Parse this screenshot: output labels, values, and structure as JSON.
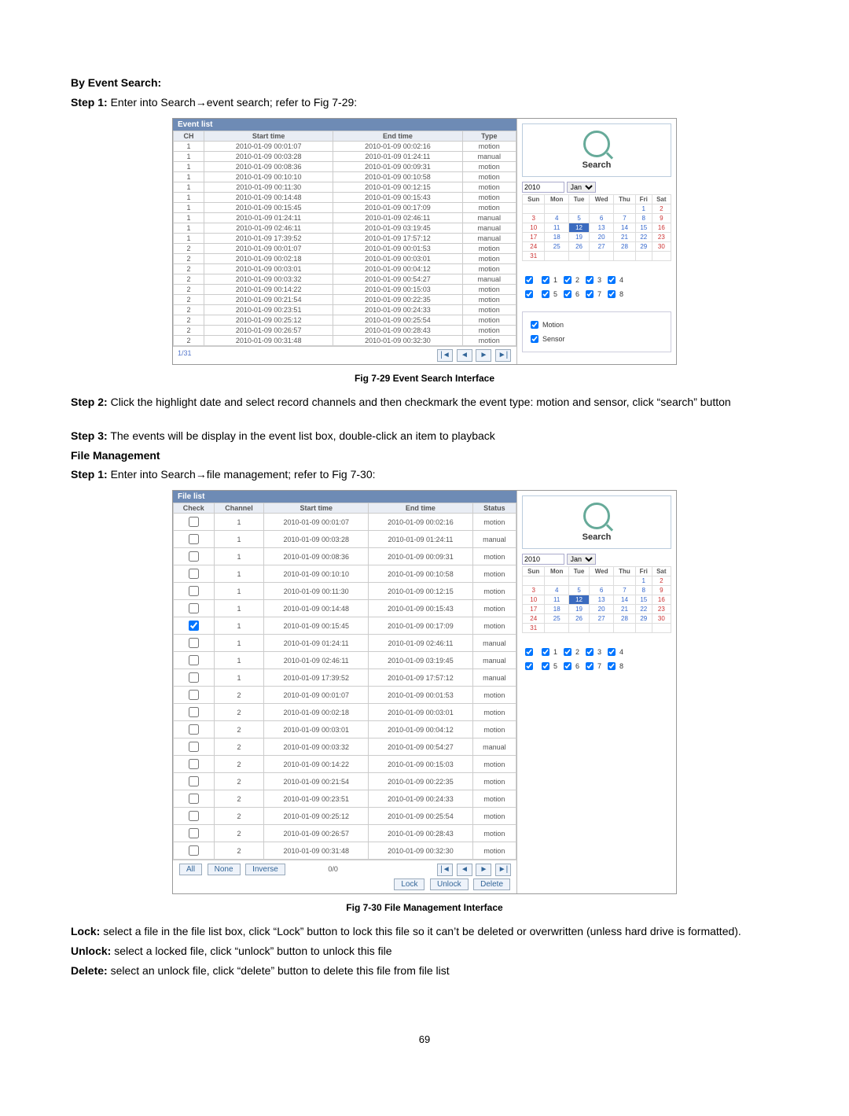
{
  "headings": {
    "by_event": "By Event Search:",
    "file_mgmt": "File Management"
  },
  "steps": {
    "e1_a": "Step 1:",
    "e1_b": " Enter into Search→event search; refer to Fig 7-29:",
    "e2_a": "Step 2:",
    "e2_b": " Click the highlight date and select record channels and then checkmark the event type: motion and sensor, click “search” button",
    "e3_a": "Step 3:",
    "e3_b": " The events will be display in the event list box, double-click an item to playback",
    "f1_a": "Step 1:",
    "f1_b": " Enter into Search→file management; refer to Fig 7-30:"
  },
  "captions": {
    "fig29": "Fig 7-29 Event Search Interface",
    "fig30": "Fig 7-30 File Management Interface"
  },
  "defs": {
    "lock_a": "Lock:",
    "lock_b": " select a file in the file list box, click “Lock” button to lock this file so it can’t be deleted or overwritten (unless hard drive is formatted).",
    "unlock_a": "Unlock:",
    "unlock_b": " select a locked file, click “unlock” button to unlock this file",
    "delete_a": "Delete:",
    "delete_b": " select an unlock file, click “delete” button to delete this file from file list"
  },
  "page_number": "69",
  "event_panel": {
    "title": "Event list",
    "cols": [
      "CH",
      "Start time",
      "End time",
      "Type"
    ],
    "rows": [
      [
        "1",
        "2010-01-09 00:01:07",
        "2010-01-09 00:02:16",
        "motion"
      ],
      [
        "1",
        "2010-01-09 00:03:28",
        "2010-01-09 01:24:11",
        "manual"
      ],
      [
        "1",
        "2010-01-09 00:08:36",
        "2010-01-09 00:09:31",
        "motion"
      ],
      [
        "1",
        "2010-01-09 00:10:10",
        "2010-01-09 00:10:58",
        "motion"
      ],
      [
        "1",
        "2010-01-09 00:11:30",
        "2010-01-09 00:12:15",
        "motion"
      ],
      [
        "1",
        "2010-01-09 00:14:48",
        "2010-01-09 00:15:43",
        "motion"
      ],
      [
        "1",
        "2010-01-09 00:15:45",
        "2010-01-09 00:17:09",
        "motion"
      ],
      [
        "1",
        "2010-01-09 01:24:11",
        "2010-01-09 02:46:11",
        "manual"
      ],
      [
        "1",
        "2010-01-09 02:46:11",
        "2010-01-09 03:19:45",
        "manual"
      ],
      [
        "1",
        "2010-01-09 17:39:52",
        "2010-01-09 17:57:12",
        "manual"
      ],
      [
        "2",
        "2010-01-09 00:01:07",
        "2010-01-09 00:01:53",
        "motion"
      ],
      [
        "2",
        "2010-01-09 00:02:18",
        "2010-01-09 00:03:01",
        "motion"
      ],
      [
        "2",
        "2010-01-09 00:03:01",
        "2010-01-09 00:04:12",
        "motion"
      ],
      [
        "2",
        "2010-01-09 00:03:32",
        "2010-01-09 00:54:27",
        "manual"
      ],
      [
        "2",
        "2010-01-09 00:14:22",
        "2010-01-09 00:15:03",
        "motion"
      ],
      [
        "2",
        "2010-01-09 00:21:54",
        "2010-01-09 00:22:35",
        "motion"
      ],
      [
        "2",
        "2010-01-09 00:23:51",
        "2010-01-09 00:24:33",
        "motion"
      ],
      [
        "2",
        "2010-01-09 00:25:12",
        "2010-01-09 00:25:54",
        "motion"
      ],
      [
        "2",
        "2010-01-09 00:26:57",
        "2010-01-09 00:28:43",
        "motion"
      ],
      [
        "2",
        "2010-01-09 00:31:48",
        "2010-01-09 00:32:30",
        "motion"
      ]
    ],
    "page": "1/31"
  },
  "file_panel": {
    "title": "File list",
    "cols": [
      "Check",
      "Channel",
      "Start time",
      "End time",
      "Status"
    ],
    "rows": [
      [
        "1",
        "2010-01-09 00:01:07",
        "2010-01-09 00:02:16",
        "motion"
      ],
      [
        "1",
        "2010-01-09 00:03:28",
        "2010-01-09 01:24:11",
        "manual"
      ],
      [
        "1",
        "2010-01-09 00:08:36",
        "2010-01-09 00:09:31",
        "motion"
      ],
      [
        "1",
        "2010-01-09 00:10:10",
        "2010-01-09 00:10:58",
        "motion"
      ],
      [
        "1",
        "2010-01-09 00:11:30",
        "2010-01-09 00:12:15",
        "motion"
      ],
      [
        "1",
        "2010-01-09 00:14:48",
        "2010-01-09 00:15:43",
        "motion"
      ],
      [
        "1",
        "2010-01-09 00:15:45",
        "2010-01-09 00:17:09",
        "motion"
      ],
      [
        "1",
        "2010-01-09 01:24:11",
        "2010-01-09 02:46:11",
        "manual"
      ],
      [
        "1",
        "2010-01-09 02:46:11",
        "2010-01-09 03:19:45",
        "manual"
      ],
      [
        "1",
        "2010-01-09 17:39:52",
        "2010-01-09 17:57:12",
        "manual"
      ],
      [
        "2",
        "2010-01-09 00:01:07",
        "2010-01-09 00:01:53",
        "motion"
      ],
      [
        "2",
        "2010-01-09 00:02:18",
        "2010-01-09 00:03:01",
        "motion"
      ],
      [
        "2",
        "2010-01-09 00:03:01",
        "2010-01-09 00:04:12",
        "motion"
      ],
      [
        "2",
        "2010-01-09 00:03:32",
        "2010-01-09 00:54:27",
        "manual"
      ],
      [
        "2",
        "2010-01-09 00:14:22",
        "2010-01-09 00:15:03",
        "motion"
      ],
      [
        "2",
        "2010-01-09 00:21:54",
        "2010-01-09 00:22:35",
        "motion"
      ],
      [
        "2",
        "2010-01-09 00:23:51",
        "2010-01-09 00:24:33",
        "motion"
      ],
      [
        "2",
        "2010-01-09 00:25:12",
        "2010-01-09 00:25:54",
        "motion"
      ],
      [
        "2",
        "2010-01-09 00:26:57",
        "2010-01-09 00:28:43",
        "motion"
      ],
      [
        "2",
        "2010-01-09 00:31:48",
        "2010-01-09 00:32:30",
        "motion"
      ]
    ],
    "checked_idx": 6,
    "footer": {
      "all": "All",
      "none": "None",
      "inverse": "Inverse",
      "page": "0/0",
      "lock": "Lock",
      "unlock": "Unlock",
      "delete": "Delete"
    }
  },
  "search_side": {
    "label": "Search",
    "year": "2010",
    "month": "Jan",
    "dow": [
      "Sun",
      "Mon",
      "Tue",
      "Wed",
      "Thu",
      "Fri",
      "Sat"
    ],
    "weeks": [
      [
        "",
        "",
        "",
        "",
        "",
        "1",
        "2"
      ],
      [
        "3",
        "4",
        "5",
        "6",
        "7",
        "8",
        "9"
      ],
      [
        "10",
        "11",
        "12",
        "13",
        "14",
        "15",
        "16"
      ],
      [
        "17",
        "18",
        "19",
        "20",
        "21",
        "22",
        "23"
      ],
      [
        "24",
        "25",
        "26",
        "27",
        "28",
        "29",
        "30"
      ],
      [
        "31",
        "",
        "",
        "",
        "",
        "",
        ""
      ]
    ],
    "selected": "12",
    "channels": [
      "1",
      "2",
      "3",
      "4",
      "5",
      "6",
      "7",
      "8"
    ],
    "evtypes": {
      "motion": "Motion",
      "sensor": "Sensor"
    }
  }
}
